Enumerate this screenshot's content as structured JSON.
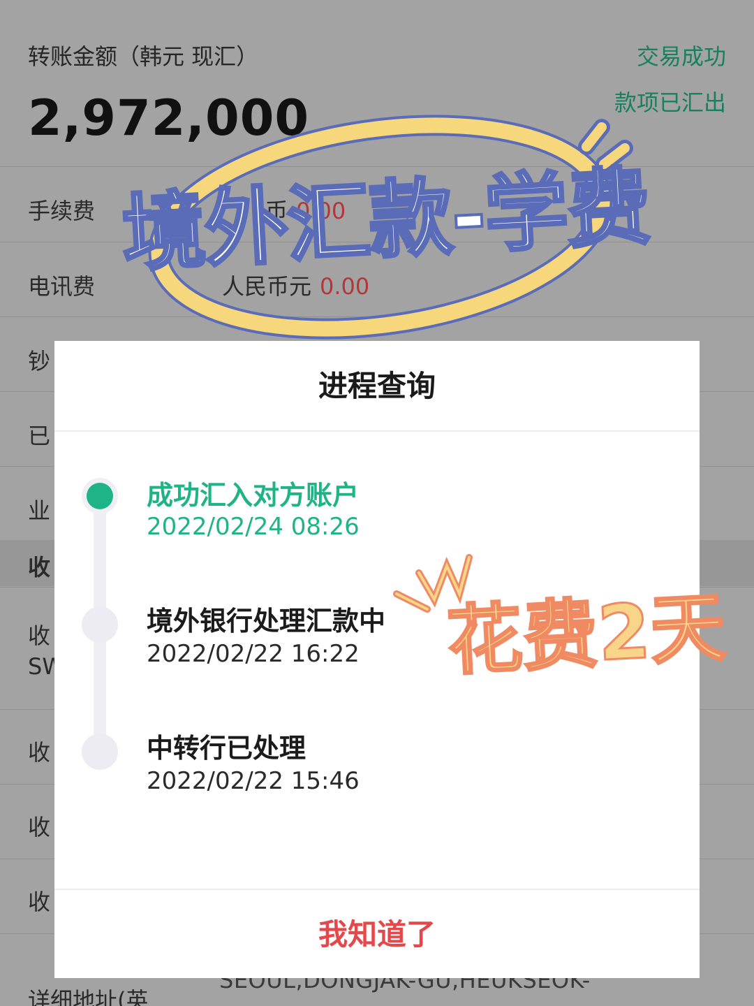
{
  "background": {
    "amount_label": "转账金额（韩元 现汇）",
    "amount_value": "2,972,000",
    "status_primary": "交易成功",
    "status_secondary": "款项已汇出",
    "rows": [
      {
        "label": "手续费",
        "value_prefix": "币",
        "value": "0.00"
      },
      {
        "label": "电讯费",
        "value_prefix": "人民币元",
        "value": "0.00"
      },
      {
        "label": "钞"
      },
      {
        "label": "已"
      },
      {
        "label": "业"
      },
      {
        "label": "收"
      },
      {
        "label": "收",
        "sub": "SW"
      },
      {
        "label": "收"
      },
      {
        "label": "收"
      },
      {
        "label": "收"
      },
      {
        "label": "详细地址(英"
      }
    ],
    "address_text": "SEOUL,DONGJAK-GU,HEUKSEOK-"
  },
  "overlay": {
    "headline": "境外汇款-学费",
    "badge": "花费2天"
  },
  "modal": {
    "title": "进程查询",
    "steps": [
      {
        "title": "成功汇入对方账户",
        "time": "2022/02/24 08:26",
        "active": true
      },
      {
        "title": "境外银行处理汇款中",
        "time": "2022/02/22 16:22",
        "active": false
      },
      {
        "title": "中转行已处理",
        "time": "2022/02/22 15:46",
        "active": false
      }
    ],
    "confirm_label": "我知道了"
  },
  "colors": {
    "accent_green": "#1fb388",
    "confirm_red": "#e5484a",
    "status_green": "#17805f"
  }
}
